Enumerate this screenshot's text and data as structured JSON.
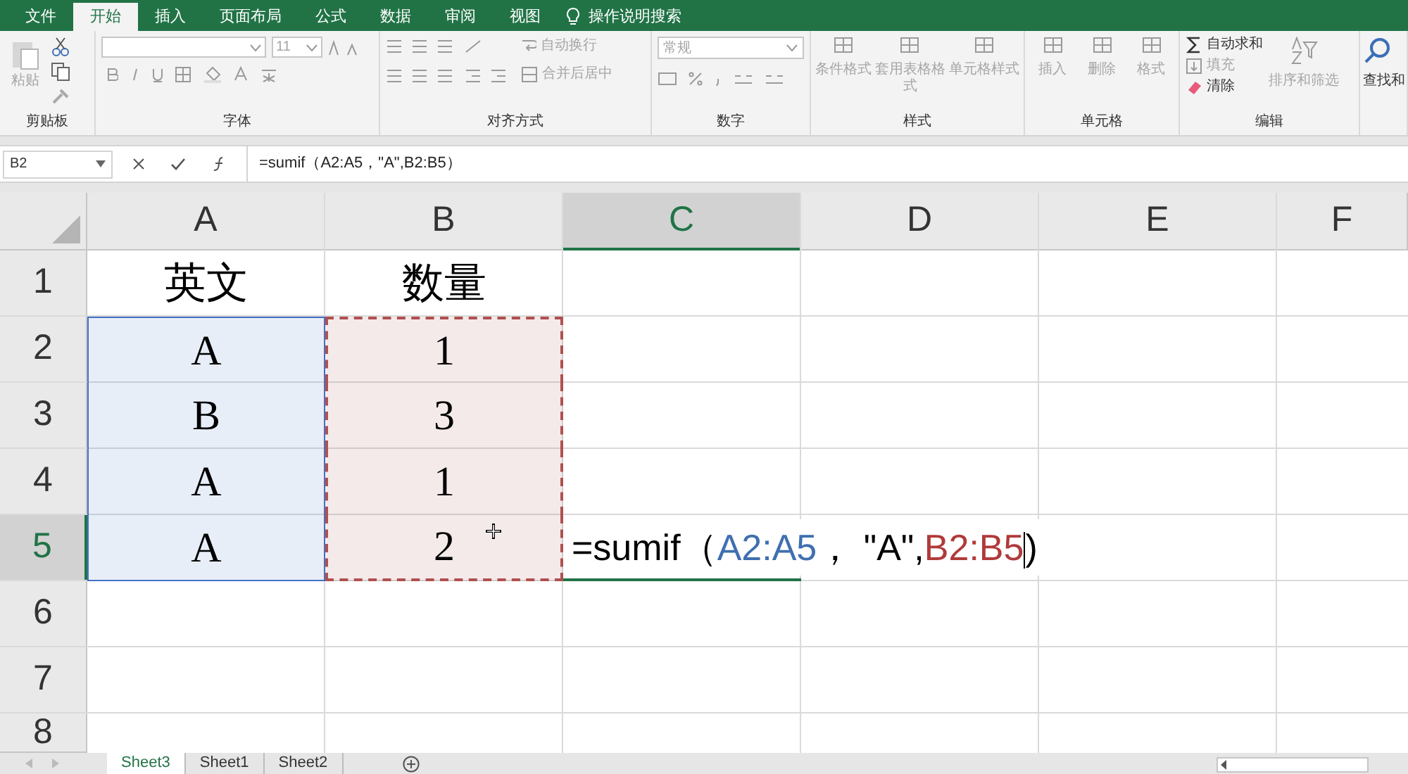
{
  "ribbon_tabs": [
    {
      "label": "文件",
      "selected": false
    },
    {
      "label": "开始",
      "selected": true
    },
    {
      "label": "插入",
      "selected": false
    },
    {
      "label": "页面布局",
      "selected": false
    },
    {
      "label": "公式",
      "selected": false
    },
    {
      "label": "数据",
      "selected": false
    },
    {
      "label": "审阅",
      "selected": false
    },
    {
      "label": "视图",
      "selected": false
    }
  ],
  "tell_me": "操作说明搜索",
  "ribbon_groups": [
    {
      "kind": "clipboard",
      "title": "剪贴板",
      "buttons": [
        {
          "label": "粘贴",
          "disabled": true
        }
      ]
    },
    {
      "kind": "font",
      "title": "字体",
      "font_size": "11"
    },
    {
      "kind": "alignment",
      "title": "对齐方式",
      "buttons": [
        {
          "label": "自动换行",
          "disabled": true
        },
        {
          "label": "合并后居中",
          "disabled": true
        }
      ]
    },
    {
      "kind": "number",
      "title": "数字",
      "format": "常规"
    },
    {
      "kind": "styles",
      "title": "样式",
      "buttons": [
        {
          "label": "条件格式",
          "disabled": true
        },
        {
          "label": "套用表格格式",
          "disabled": true
        },
        {
          "label": "单元格样式",
          "disabled": true
        }
      ]
    },
    {
      "kind": "cells",
      "title": "单元格",
      "buttons": [
        {
          "label": "插入",
          "disabled": true
        },
        {
          "label": "删除",
          "disabled": true
        },
        {
          "label": "格式",
          "disabled": true
        }
      ]
    },
    {
      "kind": "editing",
      "title": "编辑",
      "buttons": [
        {
          "label": "自动求和",
          "disabled": false
        },
        {
          "label": "填充",
          "disabled": true
        },
        {
          "label": "清除",
          "disabled": false
        },
        {
          "label": "排序和筛选",
          "disabled": true
        }
      ]
    },
    {
      "kind": "find",
      "buttons": [
        {
          "label": "查找和",
          "disabled": false
        }
      ]
    }
  ],
  "formula_bar": {
    "name_box": "B2",
    "formula": "=sumif（A2:A5，\"A\",B2:B5）"
  },
  "columns": [
    {
      "label": "A",
      "selected": false
    },
    {
      "label": "B",
      "selected": false
    },
    {
      "label": "C",
      "selected": true
    },
    {
      "label": "D",
      "selected": false
    },
    {
      "label": "E",
      "selected": false
    },
    {
      "label": "F",
      "selected": false
    }
  ],
  "rows": [
    {
      "header": "1",
      "selected": false,
      "cells": [
        {
          "text": "英文"
        },
        {
          "text": "数量"
        }
      ]
    },
    {
      "header": "2",
      "selected": false,
      "cells": [
        {
          "text": "A",
          "color": "#4472c4"
        },
        {
          "text": "1",
          "color": "#b05050"
        }
      ]
    },
    {
      "header": "3",
      "selected": false,
      "cells": [
        {
          "text": "B",
          "color": "#4472c4"
        },
        {
          "text": "3",
          "color": "#b05050"
        }
      ]
    },
    {
      "header": "4",
      "selected": false,
      "cells": [
        {
          "text": "A",
          "color": "#4472c4"
        },
        {
          "text": "1",
          "color": "#b05050"
        }
      ]
    },
    {
      "header": "5",
      "selected": true,
      "cells": [
        {
          "text": "A",
          "color": "#4472c4"
        },
        {
          "text": "2",
          "color": "#b05050"
        },
        {
          "kind": "formula",
          "parts": [
            {
              "text": "=sumif（",
              "color": "#000000"
            },
            {
              "text": "A2:A5",
              "color": "#3f6fb0"
            },
            {
              "text": "，  \"A\",",
              "color": "#000000"
            },
            {
              "text": "B2:B5",
              "color": "#b03a3a"
            },
            {
              "text": ")",
              "color": "#000000"
            }
          ]
        }
      ]
    },
    {
      "header": "6",
      "selected": false,
      "cells": []
    },
    {
      "header": "7",
      "selected": false,
      "cells": []
    },
    {
      "header": "8",
      "selected": false,
      "cells": []
    }
  ],
  "sheets": [
    {
      "label": "Sheet3",
      "selected": true
    },
    {
      "label": "Sheet1",
      "selected": false
    },
    {
      "label": "Sheet2",
      "selected": false
    }
  ]
}
